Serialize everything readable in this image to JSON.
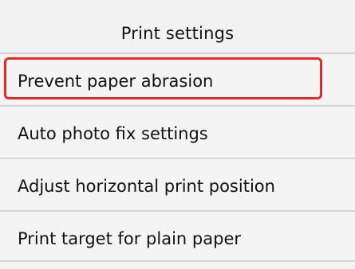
{
  "header": {
    "title": "Print settings"
  },
  "menu": {
    "items": [
      {
        "label": "Prevent paper abrasion",
        "selected": true
      },
      {
        "label": "Auto photo fix settings",
        "selected": false
      },
      {
        "label": "Adjust horizontal print position",
        "selected": false
      },
      {
        "label": "Print target for plain paper",
        "selected": false
      }
    ]
  },
  "colors": {
    "selection_border": "#e12a2a",
    "background": "#f4f4f4",
    "divider": "#d6d6d6",
    "text": "#111111"
  }
}
